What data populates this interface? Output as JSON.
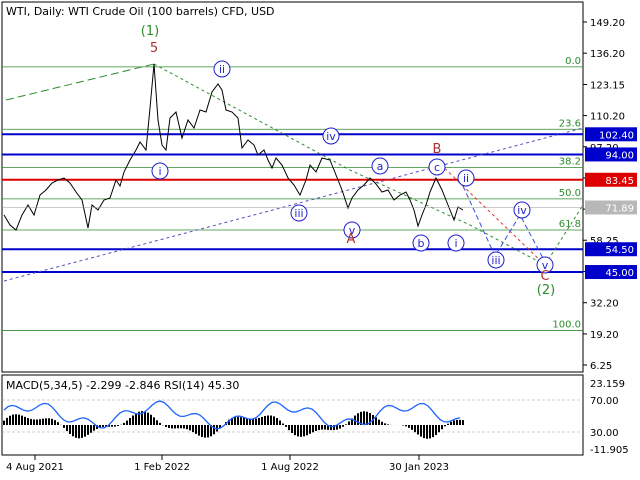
{
  "header": {
    "title": "WTI, Daily:  WTI Crude Oil (100 barrels) CFD, USD"
  },
  "indicator": {
    "label": "MACD(5,34,5) -2.299 -2.846 RSI(14) 45.30"
  },
  "colors": {
    "price": "#000000",
    "blue_level": "#0000cc",
    "red_level": "#dd0000",
    "green_level": "#2e8b2e",
    "fib_text": "#2e8b2e",
    "wave_circle": "#1f1fcc",
    "wave_red": "#b03030",
    "rsi": "#1e64ff",
    "macd_hist": "#000000",
    "macd_signal": "#8b0000",
    "price_tag": "#b8b8b8",
    "blue_tag": "#0000cc",
    "red_tag": "#dd0000"
  },
  "chart_data": [
    {
      "type": "line",
      "name": "price-panel",
      "x_tick_labels": [
        "4 Aug 2021",
        "1 Feb 2022",
        "1 Aug 2022",
        "30 Jan 2023"
      ],
      "y_tick_labels": [
        "149.20",
        "136.20",
        "123.15",
        "110.20",
        "97.20",
        "84.20",
        "71.20",
        "58.25",
        "45.20",
        "32.20",
        "19.20",
        "6.25"
      ],
      "ylim": [
        0,
        155
      ],
      "current_price": 71.89,
      "horizontal_levels": [
        {
          "value": 102.4,
          "color": "blue",
          "label": "102.40"
        },
        {
          "value": 94.0,
          "color": "blue",
          "label": "94.00"
        },
        {
          "value": 83.45,
          "color": "red",
          "label": "83.45"
        },
        {
          "value": 54.5,
          "color": "blue",
          "label": "54.50"
        },
        {
          "value": 45.0,
          "color": "blue",
          "label": "45.00"
        }
      ],
      "fibonacci": [
        {
          "label": "0.0",
          "value": 130.5
        },
        {
          "label": "23.6",
          "value": 104.5
        },
        {
          "label": "38.2",
          "value": 88.5
        },
        {
          "label": "50.0",
          "value": 75.5
        },
        {
          "label": "61.8",
          "value": 62.5
        },
        {
          "label": "100.0",
          "value": 20.6
        }
      ],
      "wave_labels": [
        {
          "text": "(1)",
          "style": "green"
        },
        {
          "text": "5",
          "style": "red"
        },
        {
          "text": "i",
          "style": "circle"
        },
        {
          "text": "ii",
          "style": "circle"
        },
        {
          "text": "iii",
          "style": "circle"
        },
        {
          "text": "iv",
          "style": "circle"
        },
        {
          "text": "v",
          "style": "circle"
        },
        {
          "text": "A",
          "style": "red"
        },
        {
          "text": "a",
          "style": "circle"
        },
        {
          "text": "B",
          "style": "red"
        },
        {
          "text": "c",
          "style": "circle"
        },
        {
          "text": "b",
          "style": "circle"
        },
        {
          "text": "i",
          "style": "circle"
        },
        {
          "text": "ii",
          "style": "circle"
        },
        {
          "text": "iii",
          "style": "circle"
        },
        {
          "text": "iv",
          "style": "circle"
        },
        {
          "text": "v",
          "style": "circle"
        },
        {
          "text": "C",
          "style": "red"
        },
        {
          "text": "(2)",
          "style": "green"
        }
      ]
    },
    {
      "type": "line",
      "name": "indicator-panel",
      "y_tick_labels": [
        "23.159",
        "70.00",
        "30.00",
        "-11.905"
      ],
      "ylim": [
        -11.905,
        23.159
      ]
    }
  ]
}
